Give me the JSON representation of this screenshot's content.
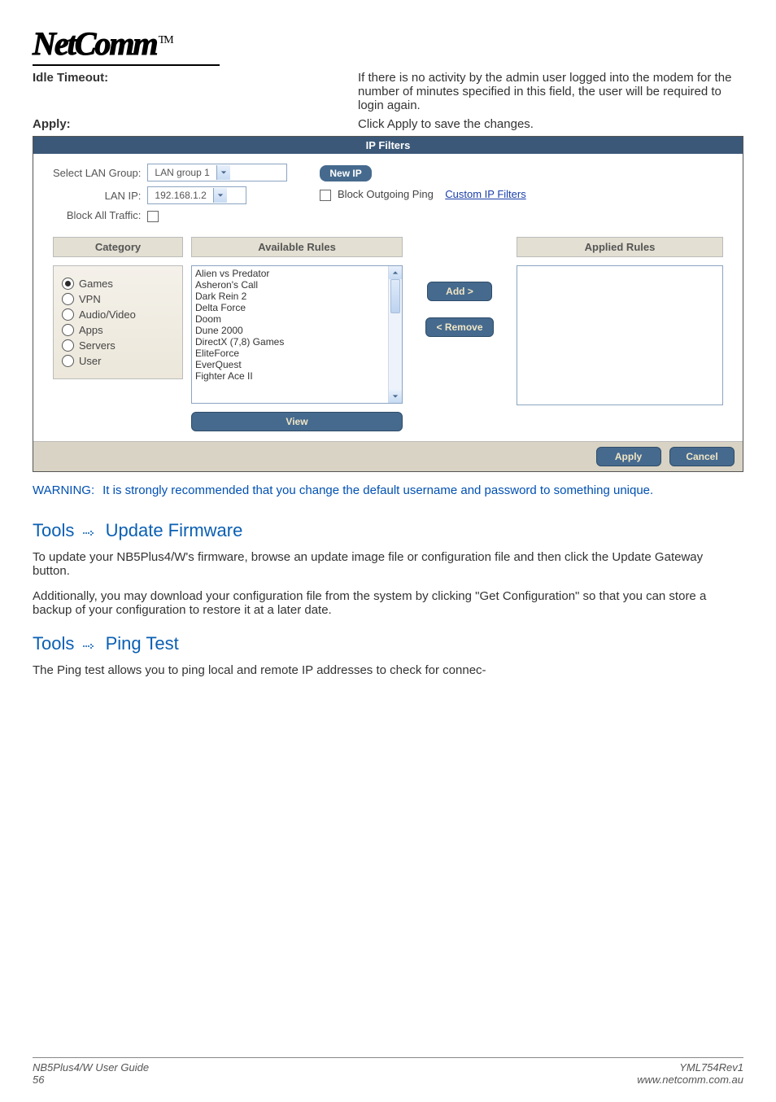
{
  "logo": {
    "text": "NetComm",
    "tm": "TM"
  },
  "defs": [
    {
      "label": "Idle Timeout:",
      "value": "If there is no activity by the admin user logged into the modem for the number of minutes specified in this field, the user will be required to login again."
    },
    {
      "label": "Apply:",
      "value": "Click  Apply to save the changes."
    }
  ],
  "ip_filters": {
    "title": "IP Filters",
    "select_lan_group_label": "Select LAN Group:",
    "select_lan_group_value": "LAN group 1",
    "lan_ip_label": "LAN IP:",
    "lan_ip_value": "192.168.1.2",
    "block_all_label": "Block All Traffic:",
    "new_ip_pill": "New IP",
    "block_outgoing_label": "Block Outgoing Ping",
    "custom_link": "Custom IP Filters",
    "category_head": "Category",
    "available_head": "Available Rules",
    "applied_head": "Applied Rules",
    "categories": [
      {
        "label": "Games",
        "checked": true
      },
      {
        "label": "VPN",
        "checked": false
      },
      {
        "label": "Audio/Video",
        "checked": false
      },
      {
        "label": "Apps",
        "checked": false
      },
      {
        "label": "Servers",
        "checked": false
      },
      {
        "label": "User",
        "checked": false
      }
    ],
    "available_rules": [
      "Alien vs Predator",
      "Asheron's Call",
      "Dark Rein 2",
      "Delta Force",
      "Doom",
      "Dune 2000",
      "DirectX (7,8) Games",
      "EliteForce",
      "EverQuest",
      "Fighter Ace II"
    ],
    "buttons": {
      "add": "Add >",
      "remove": "< Remove",
      "view": "View",
      "apply": "Apply",
      "cancel": "Cancel"
    }
  },
  "warning": {
    "tag": "WARNING:",
    "text": "It is strongly recommended that you change the default username and password to something unique."
  },
  "sections": {
    "update_heading_a": "Tools",
    "update_heading_b": "Update Firmware",
    "update_p1": "To update your NB5Plus4/W's firmware, browse an update image file or configuration file and then click the Update Gateway button.",
    "update_p2": "Additionally, you may download your configuration file from the system by clicking \"Get Configuration\" so that you can store a backup of your configuration to restore it at a later date.",
    "ping_heading_a": "Tools",
    "ping_heading_b": "Ping Test",
    "ping_p1": "The Ping test allows you to ping local and remote IP addresses to check for connec-"
  },
  "footer": {
    "left1": "NB5Plus4/W User Guide",
    "left2": "56",
    "right1": "YML754Rev1",
    "right2": "www.netcomm.com.au"
  }
}
